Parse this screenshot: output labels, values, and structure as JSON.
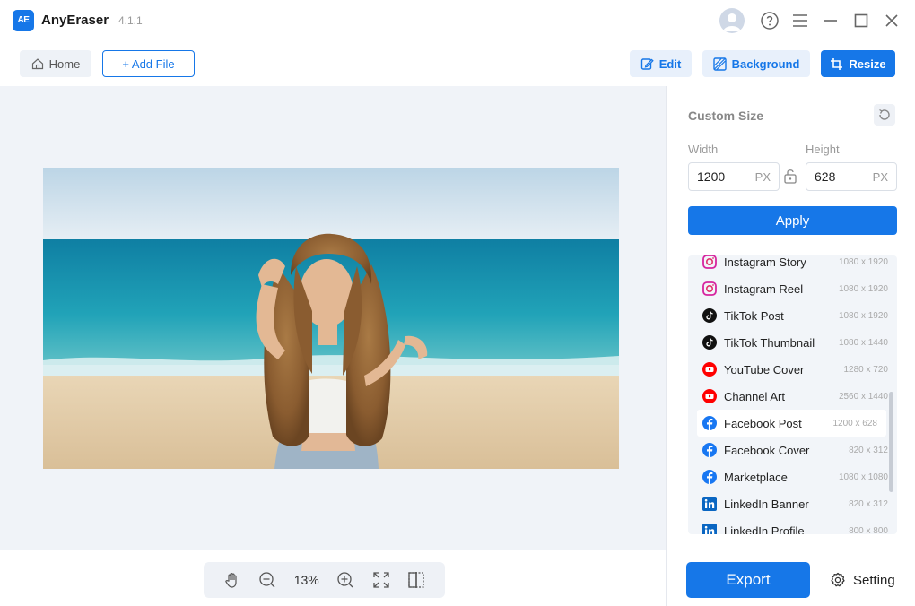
{
  "app": {
    "logo": "AE",
    "name": "AnyEraser",
    "version": "4.1.1"
  },
  "titlebar": {
    "icons": [
      "user-avatar-icon",
      "help-icon",
      "menu-icon",
      "minimize-icon",
      "maximize-icon",
      "close-icon"
    ]
  },
  "toolbar": {
    "home_label": "Home",
    "add_file_label": "+ Add File",
    "edit_label": "Edit",
    "background_label": "Background",
    "resize_label": "Resize"
  },
  "canvas": {
    "image_subject": "woman with long curly hair on a beach",
    "zoom": "13%"
  },
  "panel": {
    "title": "Custom Size",
    "width_label": "Width",
    "height_label": "Height",
    "width_value": "1200",
    "height_value": "628",
    "unit": "PX",
    "apply_label": "Apply",
    "presets": [
      {
        "name": "Instagram Story",
        "size": "1080 x 1920",
        "icon": "instagram-icon"
      },
      {
        "name": "Instagram Reel",
        "size": "1080 x 1920",
        "icon": "instagram-icon"
      },
      {
        "name": "TikTok Post",
        "size": "1080 x 1920",
        "icon": "tiktok-icon"
      },
      {
        "name": "TikTok Thumbnail",
        "size": "1080 x 1440",
        "icon": "tiktok-icon"
      },
      {
        "name": "YouTube Cover",
        "size": "1280 x 720",
        "icon": "youtube-icon"
      },
      {
        "name": "Channel Art",
        "size": "2560 x 1440",
        "icon": "youtube-icon"
      },
      {
        "name": "Facebook Post",
        "size": "1200 x 628",
        "icon": "facebook-icon",
        "selected": true
      },
      {
        "name": "Facebook Cover",
        "size": "820 x 312",
        "icon": "facebook-icon"
      },
      {
        "name": "Marketplace",
        "size": "1080 x 1080",
        "icon": "facebook-icon"
      },
      {
        "name": "LinkedIn Banner",
        "size": "820 x 312",
        "icon": "linkedin-icon"
      },
      {
        "name": "LinkedIn Profile",
        "size": "800 x 800",
        "icon": "linkedin-icon"
      }
    ]
  },
  "footer": {
    "export_label": "Export",
    "setting_label": "Setting"
  },
  "colors": {
    "accent": "#1677e8",
    "canvas_bg": "#f0f3f8",
    "sky": "#cfe0ee",
    "sea": "#1a8fb0",
    "sand": "#e8d2b0"
  }
}
